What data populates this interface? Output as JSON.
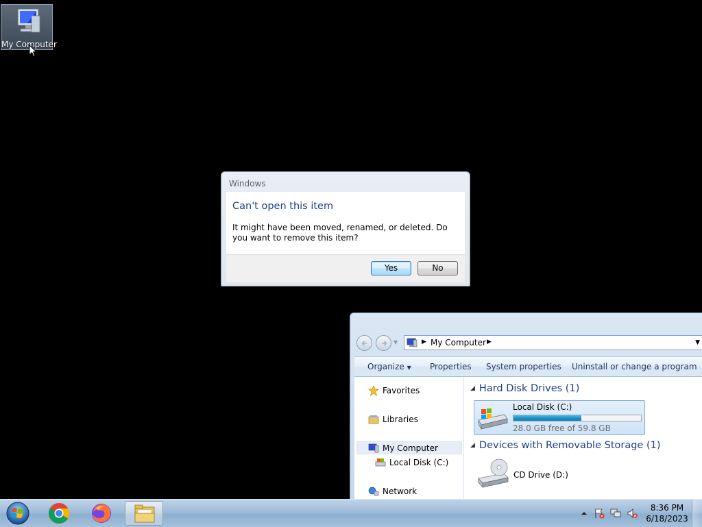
{
  "desktop": {
    "icon_label": "My Computer"
  },
  "dialog": {
    "title": "Windows",
    "heading": "Can't open this item",
    "message": "It might have been moved, renamed, or deleted. Do you want to remove this item?",
    "yes_label": "Yes",
    "no_label": "No"
  },
  "explorer": {
    "address_crumb": "My Computer",
    "toolbar": {
      "organize": "Organize",
      "properties": "Properties",
      "system_properties": "System properties",
      "uninstall": "Uninstall or change a program"
    },
    "nav": {
      "favorites": "Favorites",
      "libraries": "Libraries",
      "my_computer": "My Computer",
      "local_disk": "Local Disk (C:)",
      "network": "Network"
    },
    "groups": {
      "hard_disk": "Hard Disk Drives (1)",
      "removable": "Devices with Removable Storage (1)"
    },
    "drive_c": {
      "name": "Local Disk (C:)",
      "free_text": "28.0 GB free of 59.8 GB",
      "used_fraction": 0.53
    },
    "drive_d": {
      "name": "CD Drive (D:)"
    }
  },
  "taskbar": {
    "time": "8:36 PM",
    "date": "6/18/2023"
  },
  "colors": {
    "accent_heading": "#1c3d8c",
    "desktop_bg": "#000000"
  }
}
